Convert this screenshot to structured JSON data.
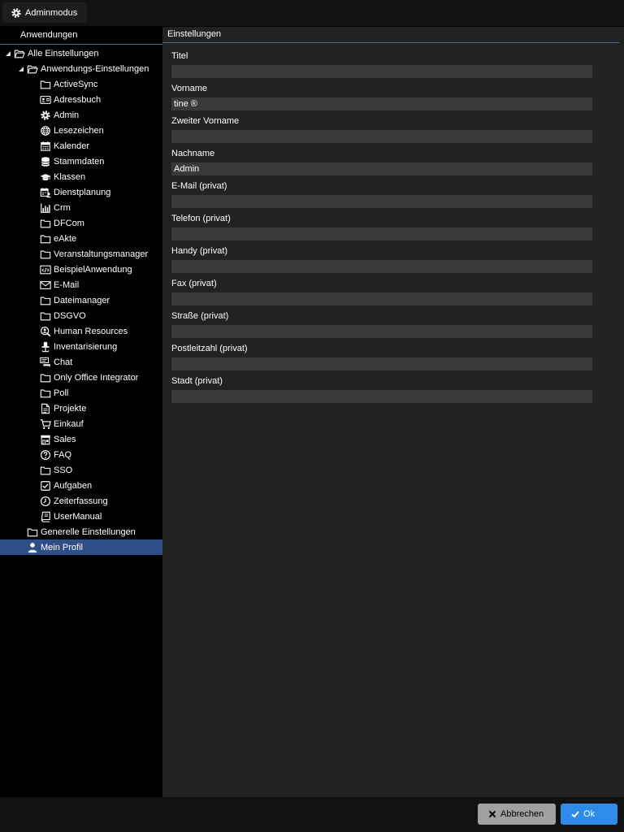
{
  "toolbar": {
    "admin_label": "Adminmodus"
  },
  "sidebar": {
    "header": "Anwendungen",
    "items": [
      {
        "label": "Alle Einstellungen",
        "icon": "folder-open-icon"
      },
      {
        "label": "Anwendungs-Einstellungen",
        "icon": "folder-open-icon"
      },
      {
        "label": "ActiveSync",
        "icon": "folder-icon"
      },
      {
        "label": "Adressbuch",
        "icon": "address-card-icon"
      },
      {
        "label": "Admin",
        "icon": "gear-icon"
      },
      {
        "label": "Lesezeichen",
        "icon": "globe-icon"
      },
      {
        "label": "Kalender",
        "icon": "calendar-icon"
      },
      {
        "label": "Stammdaten",
        "icon": "database-icon"
      },
      {
        "label": "Klassen",
        "icon": "graduation-cap-icon"
      },
      {
        "label": "Dienstplanung",
        "icon": "calendar-user-icon"
      },
      {
        "label": "Crm",
        "icon": "bar-chart-icon"
      },
      {
        "label": "DFCom",
        "icon": "folder-icon"
      },
      {
        "label": "eAkte",
        "icon": "folder-icon"
      },
      {
        "label": "Veranstaltungsmanager",
        "icon": "folder-icon"
      },
      {
        "label": "BeispielAnwendung",
        "icon": "code-window-icon"
      },
      {
        "label": "E-Mail",
        "icon": "envelope-icon"
      },
      {
        "label": "Dateimanager",
        "icon": "folder-icon"
      },
      {
        "label": "DSGVO",
        "icon": "folder-icon"
      },
      {
        "label": "Human Resources",
        "icon": "user-search-icon"
      },
      {
        "label": "Inventarisierung",
        "icon": "office-chair-icon"
      },
      {
        "label": "Chat",
        "icon": "chat-icon"
      },
      {
        "label": "Only Office Integrator",
        "icon": "folder-icon"
      },
      {
        "label": "Poll",
        "icon": "folder-icon"
      },
      {
        "label": "Projekte",
        "icon": "document-icon"
      },
      {
        "label": "Einkauf",
        "icon": "shopping-cart-icon"
      },
      {
        "label": "Sales",
        "icon": "store-icon"
      },
      {
        "label": "FAQ",
        "icon": "question-circle-icon"
      },
      {
        "label": "SSO",
        "icon": "folder-icon"
      },
      {
        "label": "Aufgaben",
        "icon": "checkbox-icon"
      },
      {
        "label": "Zeiterfassung",
        "icon": "clock-icon"
      },
      {
        "label": "UserManual",
        "icon": "book-icon"
      },
      {
        "label": "Generelle Einstellungen",
        "icon": "folder-icon"
      },
      {
        "label": "Mein Profil",
        "icon": "user-icon"
      }
    ]
  },
  "main": {
    "header": "Einstellungen",
    "fields": [
      {
        "label": "Titel",
        "value": ""
      },
      {
        "label": "Vorname",
        "value": "tine ®"
      },
      {
        "label": "Zweiter Vorname",
        "value": ""
      },
      {
        "label": "Nachname",
        "value": "Admin"
      },
      {
        "label": "E-Mail (privat)",
        "value": ""
      },
      {
        "label": "Telefon (privat)",
        "value": ""
      },
      {
        "label": "Handy (privat)",
        "value": ""
      },
      {
        "label": "Fax (privat)",
        "value": ""
      },
      {
        "label": "Straße (privat)",
        "value": ""
      },
      {
        "label": "Postleitzahl (privat)",
        "value": ""
      },
      {
        "label": "Stadt (privat)",
        "value": ""
      }
    ]
  },
  "footer": {
    "cancel_label": "Abbrechen",
    "ok_label": "Ok"
  },
  "colors": {
    "background": "#000000",
    "panel": "#222222",
    "input": "#3a3a3a",
    "selected_row": "#2e4f85",
    "ok_button": "#2e8ce8",
    "cancel_button": "#a0a0a0",
    "header_line": "#4a6a95"
  }
}
